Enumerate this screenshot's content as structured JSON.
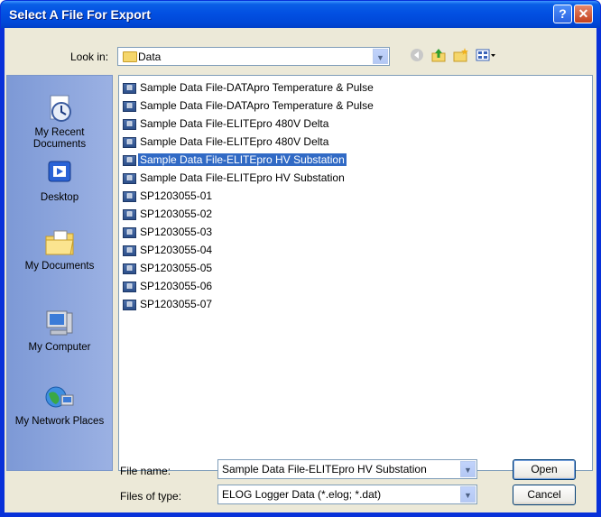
{
  "window": {
    "title": "Select A File For Export"
  },
  "titlebar": {
    "help_label": "?",
    "close_label": "✕"
  },
  "lookin": {
    "label": "Look in:",
    "value": "Data"
  },
  "toolbar": {
    "back": "back-icon",
    "up": "up-folder-icon",
    "new_folder": "new-folder-icon",
    "views": "views-menu-icon"
  },
  "places": [
    {
      "label": "My Recent Documents",
      "icon": "recent-documents-icon"
    },
    {
      "label": "Desktop",
      "icon": "desktop-icon"
    },
    {
      "label": "My Documents",
      "icon": "my-documents-icon"
    },
    {
      "label": "My Computer",
      "icon": "my-computer-icon"
    },
    {
      "label": "My Network Places",
      "icon": "network-places-icon"
    }
  ],
  "files": [
    {
      "name": "Sample Data File-DATApro Temperature & Pulse",
      "selected": false
    },
    {
      "name": "Sample Data File-DATApro Temperature & Pulse",
      "selected": false
    },
    {
      "name": "Sample Data File-ELITEpro 480V Delta",
      "selected": false
    },
    {
      "name": "Sample Data File-ELITEpro 480V Delta",
      "selected": false
    },
    {
      "name": "Sample Data File-ELITEpro HV Substation",
      "selected": true
    },
    {
      "name": "Sample Data File-ELITEpro HV Substation",
      "selected": false
    },
    {
      "name": "SP1203055-01",
      "selected": false
    },
    {
      "name": "SP1203055-02",
      "selected": false
    },
    {
      "name": "SP1203055-03",
      "selected": false
    },
    {
      "name": "SP1203055-04",
      "selected": false
    },
    {
      "name": "SP1203055-05",
      "selected": false
    },
    {
      "name": "SP1203055-06",
      "selected": false
    },
    {
      "name": "SP1203055-07",
      "selected": false
    }
  ],
  "filename": {
    "label": "File name:",
    "value": "Sample Data File-ELITEpro HV Substation"
  },
  "filetype": {
    "label": "Files of type:",
    "value": "ELOG Logger Data (*.elog; *.dat)"
  },
  "buttons": {
    "open": "Open",
    "cancel": "Cancel"
  },
  "colors": {
    "title_bar": "#0054e3",
    "selection": "#316ac5",
    "places_bar": "#8ba3d9",
    "dialog_bg": "#ece9d8"
  }
}
